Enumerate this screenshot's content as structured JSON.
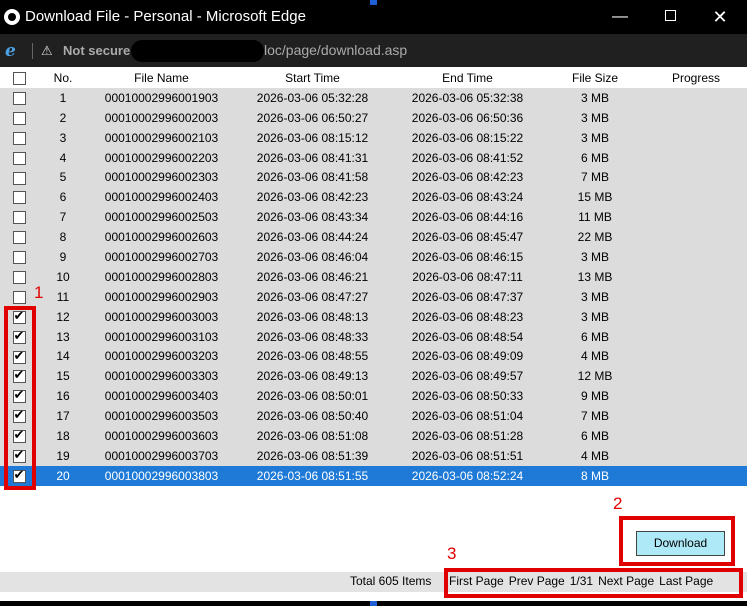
{
  "window": {
    "title": "Download File - Personal - Microsoft Edge",
    "minimize": "—",
    "close": "✕"
  },
  "address": {
    "security": "Not secure",
    "url": "loc/page/download.asp"
  },
  "grid": {
    "columns": [
      "No.",
      "File Name",
      "Start Time",
      "End Time",
      "File Size",
      "Progress"
    ],
    "rows": [
      {
        "no": "1",
        "name": "00010002996001903",
        "start": "2026-03-06 05:32:28",
        "end": "2026-03-06 05:32:38",
        "size": "3 MB",
        "progress": "",
        "checked": false
      },
      {
        "no": "2",
        "name": "00010002996002003",
        "start": "2026-03-06 06:50:27",
        "end": "2026-03-06 06:50:36",
        "size": "3 MB",
        "progress": "",
        "checked": false
      },
      {
        "no": "3",
        "name": "00010002996002103",
        "start": "2026-03-06 08:15:12",
        "end": "2026-03-06 08:15:22",
        "size": "3 MB",
        "progress": "",
        "checked": false
      },
      {
        "no": "4",
        "name": "00010002996002203",
        "start": "2026-03-06 08:41:31",
        "end": "2026-03-06 08:41:52",
        "size": "6 MB",
        "progress": "",
        "checked": false
      },
      {
        "no": "5",
        "name": "00010002996002303",
        "start": "2026-03-06 08:41:58",
        "end": "2026-03-06 08:42:23",
        "size": "7 MB",
        "progress": "",
        "checked": false
      },
      {
        "no": "6",
        "name": "00010002996002403",
        "start": "2026-03-06 08:42:23",
        "end": "2026-03-06 08:43:24",
        "size": "15 MB",
        "progress": "",
        "checked": false
      },
      {
        "no": "7",
        "name": "00010002996002503",
        "start": "2026-03-06 08:43:34",
        "end": "2026-03-06 08:44:16",
        "size": "11 MB",
        "progress": "",
        "checked": false
      },
      {
        "no": "8",
        "name": "00010002996002603",
        "start": "2026-03-06 08:44:24",
        "end": "2026-03-06 08:45:47",
        "size": "22 MB",
        "progress": "",
        "checked": false
      },
      {
        "no": "9",
        "name": "00010002996002703",
        "start": "2026-03-06 08:46:04",
        "end": "2026-03-06 08:46:15",
        "size": "3 MB",
        "progress": "",
        "checked": false
      },
      {
        "no": "10",
        "name": "00010002996002803",
        "start": "2026-03-06 08:46:21",
        "end": "2026-03-06 08:47:11",
        "size": "13 MB",
        "progress": "",
        "checked": false
      },
      {
        "no": "11",
        "name": "00010002996002903",
        "start": "2026-03-06 08:47:27",
        "end": "2026-03-06 08:47:37",
        "size": "3 MB",
        "progress": "",
        "checked": false
      },
      {
        "no": "12",
        "name": "00010002996003003",
        "start": "2026-03-06 08:48:13",
        "end": "2026-03-06 08:48:23",
        "size": "3 MB",
        "progress": "",
        "checked": true
      },
      {
        "no": "13",
        "name": "00010002996003103",
        "start": "2026-03-06 08:48:33",
        "end": "2026-03-06 08:48:54",
        "size": "6 MB",
        "progress": "",
        "checked": true
      },
      {
        "no": "14",
        "name": "00010002996003203",
        "start": "2026-03-06 08:48:55",
        "end": "2026-03-06 08:49:09",
        "size": "4 MB",
        "progress": "",
        "checked": true
      },
      {
        "no": "15",
        "name": "00010002996003303",
        "start": "2026-03-06 08:49:13",
        "end": "2026-03-06 08:49:57",
        "size": "12 MB",
        "progress": "",
        "checked": true
      },
      {
        "no": "16",
        "name": "00010002996003403",
        "start": "2026-03-06 08:50:01",
        "end": "2026-03-06 08:50:33",
        "size": "9 MB",
        "progress": "",
        "checked": true
      },
      {
        "no": "17",
        "name": "00010002996003503",
        "start": "2026-03-06 08:50:40",
        "end": "2026-03-06 08:51:04",
        "size": "7 MB",
        "progress": "",
        "checked": true
      },
      {
        "no": "18",
        "name": "00010002996003603",
        "start": "2026-03-06 08:51:08",
        "end": "2026-03-06 08:51:28",
        "size": "6 MB",
        "progress": "",
        "checked": true
      },
      {
        "no": "19",
        "name": "00010002996003703",
        "start": "2026-03-06 08:51:39",
        "end": "2026-03-06 08:51:51",
        "size": "4 MB",
        "progress": "",
        "checked": true
      },
      {
        "no": "20",
        "name": "00010002996003803",
        "start": "2026-03-06 08:51:55",
        "end": "2026-03-06 08:52:24",
        "size": "8 MB",
        "progress": "",
        "checked": true
      }
    ],
    "selected_row": "20"
  },
  "actions": {
    "download_label": "Download"
  },
  "footer": {
    "total": "Total 605 Items",
    "first": "First Page",
    "prev": "Prev Page",
    "page_info": "1/31",
    "next": "Next Page",
    "last": "Last Page"
  },
  "annotations": {
    "marker_1": "1",
    "marker_2": "2",
    "marker_3": "3"
  },
  "colors": {
    "highlight": "#e10000",
    "selected_row": "#1e7ad6",
    "row_background": "#dcdcdc",
    "download_button": "#aee9f7"
  }
}
